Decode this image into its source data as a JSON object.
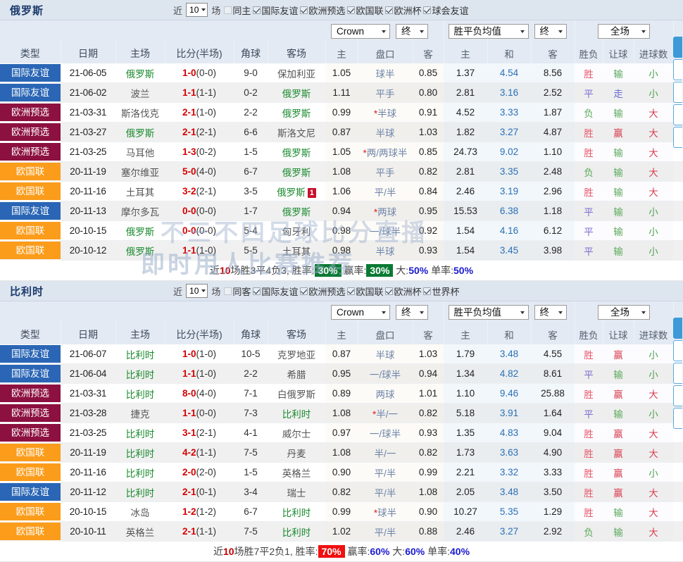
{
  "panels": [
    {
      "title": "俄罗斯",
      "controls": {
        "recent_label": "近",
        "count": "10",
        "matches_label": "场",
        "same_side_label": "同主",
        "same_side_checked": false,
        "filters": [
          {
            "label": "国际友谊",
            "checked": true
          },
          {
            "label": "欧洲预选",
            "checked": true
          },
          {
            "label": "欧国联",
            "checked": true
          },
          {
            "label": "欧洲杯",
            "checked": true
          },
          {
            "label": "球会友谊",
            "checked": true
          }
        ]
      },
      "selects": {
        "company": "Crown",
        "odds_stage": "终",
        "odds_type": "胜平负均值",
        "odds_stage2": "终",
        "period": "全场"
      },
      "columns": [
        "类型",
        "日期",
        "主场",
        "比分(半场)",
        "角球",
        "客场"
      ],
      "sub_columns": [
        "主",
        "盘口",
        "客",
        "主",
        "和",
        "客",
        "胜负",
        "让球",
        "进球数"
      ],
      "rows": [
        {
          "tag": "国际友谊",
          "tagclass": "friendly",
          "date": "21-06-05",
          "home": "俄罗斯",
          "home_hi": true,
          "score": "1-0",
          "half": "(0-0)",
          "corner": "9-0",
          "away": "保加利亚",
          "away_hi": false,
          "badge": "",
          "h_odds": "1.05",
          "handicap": "球半",
          "star": false,
          "a_odds": "0.85",
          "w": "1.37",
          "d": "4.54",
          "l": "8.56",
          "res": "胜",
          "res_c": "r-win",
          "hcp": "输",
          "hcp_c": "r-lose",
          "ou": "小",
          "ou_c": "r-green"
        },
        {
          "tag": "国际友谊",
          "tagclass": "friendly",
          "date": "21-06-02",
          "home": "波兰",
          "home_hi": false,
          "score": "1-1",
          "half": "(1-1)",
          "corner": "0-2",
          "away": "俄罗斯",
          "away_hi": true,
          "badge": "",
          "h_odds": "1.11",
          "handicap": "平手",
          "star": false,
          "a_odds": "0.80",
          "w": "2.81",
          "d": "3.16",
          "l": "2.52",
          "res": "平",
          "res_c": "r-draw",
          "hcp": "走",
          "hcp_c": "r-blue",
          "ou": "小",
          "ou_c": "r-green"
        },
        {
          "tag": "欧洲预选",
          "tagclass": "euroqual",
          "date": "21-03-31",
          "home": "斯洛伐克",
          "home_hi": false,
          "score": "2-1",
          "half": "(1-0)",
          "corner": "2-2",
          "away": "俄罗斯",
          "away_hi": true,
          "badge": "",
          "h_odds": "0.99",
          "handicap": "半球",
          "star": true,
          "a_odds": "0.91",
          "w": "4.52",
          "d": "3.33",
          "l": "1.87",
          "res": "负",
          "res_c": "r-lose",
          "hcp": "输",
          "hcp_c": "r-lose",
          "ou": "大",
          "ou_c": "r-red"
        },
        {
          "tag": "欧洲预选",
          "tagclass": "euroqual",
          "date": "21-03-27",
          "home": "俄罗斯",
          "home_hi": true,
          "score": "2-1",
          "half": "(2-1)",
          "corner": "6-6",
          "away": "斯洛文尼",
          "away_hi": false,
          "badge": "",
          "h_odds": "0.87",
          "handicap": "半球",
          "star": false,
          "a_odds": "1.03",
          "w": "1.82",
          "d": "3.27",
          "l": "4.87",
          "res": "胜",
          "res_c": "r-win",
          "hcp": "赢",
          "hcp_c": "r-red",
          "ou": "大",
          "ou_c": "r-red"
        },
        {
          "tag": "欧洲预选",
          "tagclass": "euroqual",
          "date": "21-03-25",
          "home": "马耳他",
          "home_hi": false,
          "score": "1-3",
          "half": "(0-2)",
          "corner": "1-5",
          "away": "俄罗斯",
          "away_hi": true,
          "badge": "",
          "h_odds": "1.05",
          "handicap": "两/两球半",
          "star": true,
          "a_odds": "0.85",
          "w": "24.73",
          "d": "9.02",
          "l": "1.10",
          "res": "胜",
          "res_c": "r-win",
          "hcp": "输",
          "hcp_c": "r-lose",
          "ou": "大",
          "ou_c": "r-red"
        },
        {
          "tag": "欧国联",
          "tagclass": "nationsleague",
          "date": "20-11-19",
          "home": "塞尔维亚",
          "home_hi": false,
          "score": "5-0",
          "half": "(4-0)",
          "corner": "6-7",
          "away": "俄罗斯",
          "away_hi": true,
          "badge": "",
          "h_odds": "1.08",
          "handicap": "平手",
          "star": false,
          "a_odds": "0.82",
          "w": "2.81",
          "d": "3.35",
          "l": "2.48",
          "res": "负",
          "res_c": "r-lose",
          "hcp": "输",
          "hcp_c": "r-lose",
          "ou": "大",
          "ou_c": "r-red"
        },
        {
          "tag": "欧国联",
          "tagclass": "nationsleague",
          "date": "20-11-16",
          "home": "土耳其",
          "home_hi": false,
          "score": "3-2",
          "half": "(2-1)",
          "corner": "3-5",
          "away": "俄罗斯",
          "away_hi": true,
          "badge": "1",
          "h_odds": "1.06",
          "handicap": "平/半",
          "star": false,
          "a_odds": "0.84",
          "w": "2.46",
          "d": "3.19",
          "l": "2.96",
          "res": "胜",
          "res_c": "r-win",
          "hcp": "输",
          "hcp_c": "r-lose",
          "ou": "大",
          "ou_c": "r-red"
        },
        {
          "tag": "国际友谊",
          "tagclass": "friendly",
          "date": "20-11-13",
          "home": "摩尔多瓦",
          "home_hi": false,
          "score": "0-0",
          "half": "(0-0)",
          "corner": "1-7",
          "away": "俄罗斯",
          "away_hi": true,
          "badge": "",
          "h_odds": "0.94",
          "handicap": "两球",
          "star": true,
          "a_odds": "0.95",
          "w": "15.53",
          "d": "6.38",
          "l": "1.18",
          "res": "平",
          "res_c": "r-draw",
          "hcp": "输",
          "hcp_c": "r-lose",
          "ou": "小",
          "ou_c": "r-green"
        },
        {
          "tag": "欧国联",
          "tagclass": "nationsleague",
          "date": "20-10-15",
          "home": "俄罗斯",
          "home_hi": true,
          "score": "0-0",
          "half": "(0-0)",
          "corner": "5-4",
          "away": "匈牙利",
          "away_hi": false,
          "badge": "",
          "h_odds": "0.98",
          "handicap": "一/球半",
          "star": false,
          "a_odds": "0.92",
          "w": "1.54",
          "d": "4.16",
          "l": "6.12",
          "res": "平",
          "res_c": "r-draw",
          "hcp": "输",
          "hcp_c": "r-lose",
          "ou": "小",
          "ou_c": "r-green"
        },
        {
          "tag": "欧国联",
          "tagclass": "nationsleague",
          "date": "20-10-12",
          "home": "俄罗斯",
          "home_hi": true,
          "score": "1-1",
          "half": "(1-0)",
          "corner": "5-5",
          "away": "土耳其",
          "away_hi": false,
          "badge": "",
          "h_odds": "0.98",
          "handicap": "半球",
          "star": false,
          "a_odds": "0.93",
          "w": "1.54",
          "d": "3.45",
          "l": "3.98",
          "res": "平",
          "res_c": "r-draw",
          "hcp": "输",
          "hcp_c": "r-lose",
          "ou": "小",
          "ou_c": "r-green"
        }
      ],
      "summary": {
        "prefix": "近",
        "count": "10",
        "matches": "场",
        "record": "胜3平4负3,",
        "winrate_label": "胜率:",
        "winrate": "30%",
        "hcprate_label": "赢率:",
        "hcprate": "30%",
        "over_label": "大:",
        "over": "50%",
        "odd_label": "单率:",
        "odd": "50%",
        "winrate_style": "green",
        "hcprate_style": "green"
      }
    },
    {
      "title": "比利时",
      "controls": {
        "recent_label": "近",
        "count": "10",
        "matches_label": "场",
        "same_side_label": "同客",
        "same_side_checked": false,
        "filters": [
          {
            "label": "国际友谊",
            "checked": true
          },
          {
            "label": "欧洲预选",
            "checked": true
          },
          {
            "label": "欧国联",
            "checked": true
          },
          {
            "label": "欧洲杯",
            "checked": true
          },
          {
            "label": "世界杯",
            "checked": true
          }
        ]
      },
      "selects": {
        "company": "Crown",
        "odds_stage": "终",
        "odds_type": "胜平负均值",
        "odds_stage2": "终",
        "period": "全场"
      },
      "columns": [
        "类型",
        "日期",
        "主场",
        "比分(半场)",
        "角球",
        "客场"
      ],
      "sub_columns": [
        "主",
        "盘口",
        "客",
        "主",
        "和",
        "客",
        "胜负",
        "让球",
        "进球数"
      ],
      "rows": [
        {
          "tag": "国际友谊",
          "tagclass": "friendly",
          "date": "21-06-07",
          "home": "比利时",
          "home_hi": true,
          "score": "1-0",
          "half": "(1-0)",
          "corner": "10-5",
          "away": "克罗地亚",
          "away_hi": false,
          "badge": "",
          "h_odds": "0.87",
          "handicap": "半球",
          "star": false,
          "a_odds": "1.03",
          "w": "1.79",
          "d": "3.48",
          "l": "4.55",
          "res": "胜",
          "res_c": "r-win",
          "hcp": "赢",
          "hcp_c": "r-red",
          "ou": "小",
          "ou_c": "r-green"
        },
        {
          "tag": "国际友谊",
          "tagclass": "friendly",
          "date": "21-06-04",
          "home": "比利时",
          "home_hi": true,
          "score": "1-1",
          "half": "(1-0)",
          "corner": "2-2",
          "away": "希腊",
          "away_hi": false,
          "badge": "",
          "h_odds": "0.95",
          "handicap": "一/球半",
          "star": false,
          "a_odds": "0.94",
          "w": "1.34",
          "d": "4.82",
          "l": "8.61",
          "res": "平",
          "res_c": "r-draw",
          "hcp": "输",
          "hcp_c": "r-lose",
          "ou": "小",
          "ou_c": "r-green"
        },
        {
          "tag": "欧洲预选",
          "tagclass": "euroqual",
          "date": "21-03-31",
          "home": "比利时",
          "home_hi": true,
          "score": "8-0",
          "half": "(4-0)",
          "corner": "7-1",
          "away": "白俄罗斯",
          "away_hi": false,
          "badge": "",
          "h_odds": "0.89",
          "handicap": "两球",
          "star": false,
          "a_odds": "1.01",
          "w": "1.10",
          "d": "9.46",
          "l": "25.88",
          "res": "胜",
          "res_c": "r-win",
          "hcp": "赢",
          "hcp_c": "r-red",
          "ou": "大",
          "ou_c": "r-red"
        },
        {
          "tag": "欧洲预选",
          "tagclass": "euroqual",
          "date": "21-03-28",
          "home": "捷克",
          "home_hi": false,
          "score": "1-1",
          "half": "(0-0)",
          "corner": "7-3",
          "away": "比利时",
          "away_hi": true,
          "badge": "",
          "h_odds": "1.08",
          "handicap": "半/一",
          "star": true,
          "a_odds": "0.82",
          "w": "5.18",
          "d": "3.91",
          "l": "1.64",
          "res": "平",
          "res_c": "r-draw",
          "hcp": "输",
          "hcp_c": "r-lose",
          "ou": "小",
          "ou_c": "r-green"
        },
        {
          "tag": "欧洲预选",
          "tagclass": "euroqual",
          "date": "21-03-25",
          "home": "比利时",
          "home_hi": true,
          "score": "3-1",
          "half": "(2-1)",
          "corner": "4-1",
          "away": "威尔士",
          "away_hi": false,
          "badge": "",
          "h_odds": "0.97",
          "handicap": "一/球半",
          "star": false,
          "a_odds": "0.93",
          "w": "1.35",
          "d": "4.83",
          "l": "9.04",
          "res": "胜",
          "res_c": "r-win",
          "hcp": "赢",
          "hcp_c": "r-red",
          "ou": "大",
          "ou_c": "r-red"
        },
        {
          "tag": "欧国联",
          "tagclass": "nationsleague",
          "date": "20-11-19",
          "home": "比利时",
          "home_hi": true,
          "score": "4-2",
          "half": "(1-1)",
          "corner": "7-5",
          "away": "丹麦",
          "away_hi": false,
          "badge": "",
          "h_odds": "1.08",
          "handicap": "半/一",
          "star": false,
          "a_odds": "0.82",
          "w": "1.73",
          "d": "3.63",
          "l": "4.90",
          "res": "胜",
          "res_c": "r-win",
          "hcp": "赢",
          "hcp_c": "r-red",
          "ou": "大",
          "ou_c": "r-red"
        },
        {
          "tag": "欧国联",
          "tagclass": "nationsleague",
          "date": "20-11-16",
          "home": "比利时",
          "home_hi": true,
          "score": "2-0",
          "half": "(2-0)",
          "corner": "1-5",
          "away": "英格兰",
          "away_hi": false,
          "badge": "",
          "h_odds": "0.90",
          "handicap": "平/半",
          "star": false,
          "a_odds": "0.99",
          "w": "2.21",
          "d": "3.32",
          "l": "3.33",
          "res": "胜",
          "res_c": "r-win",
          "hcp": "赢",
          "hcp_c": "r-red",
          "ou": "小",
          "ou_c": "r-green"
        },
        {
          "tag": "国际友谊",
          "tagclass": "friendly",
          "date": "20-11-12",
          "home": "比利时",
          "home_hi": true,
          "score": "2-1",
          "half": "(0-1)",
          "corner": "3-4",
          "away": "瑞士",
          "away_hi": false,
          "badge": "",
          "h_odds": "0.82",
          "handicap": "平/半",
          "star": false,
          "a_odds": "1.08",
          "w": "2.05",
          "d": "3.48",
          "l": "3.50",
          "res": "胜",
          "res_c": "r-win",
          "hcp": "赢",
          "hcp_c": "r-red",
          "ou": "大",
          "ou_c": "r-red"
        },
        {
          "tag": "欧国联",
          "tagclass": "nationsleague",
          "date": "20-10-15",
          "home": "冰岛",
          "home_hi": false,
          "score": "1-2",
          "half": "(1-2)",
          "corner": "6-7",
          "away": "比利时",
          "away_hi": true,
          "badge": "",
          "h_odds": "0.99",
          "handicap": "球半",
          "star": true,
          "a_odds": "0.90",
          "w": "10.27",
          "d": "5.35",
          "l": "1.29",
          "res": "胜",
          "res_c": "r-win",
          "hcp": "输",
          "hcp_c": "r-lose",
          "ou": "大",
          "ou_c": "r-red"
        },
        {
          "tag": "欧国联",
          "tagclass": "nationsleague",
          "date": "20-10-11",
          "home": "英格兰",
          "home_hi": false,
          "score": "2-1",
          "half": "(1-1)",
          "corner": "7-5",
          "away": "比利时",
          "away_hi": true,
          "badge": "",
          "h_odds": "1.02",
          "handicap": "平/半",
          "star": false,
          "a_odds": "0.88",
          "w": "2.46",
          "d": "3.27",
          "l": "2.92",
          "res": "负",
          "res_c": "r-lose",
          "hcp": "输",
          "hcp_c": "r-lose",
          "ou": "大",
          "ou_c": "r-red"
        }
      ],
      "summary": {
        "prefix": "近",
        "count": "10",
        "matches": "场",
        "record": "胜7平2负1,",
        "winrate_label": "胜率:",
        "winrate": "70%",
        "hcprate_label": "赢率:",
        "hcprate": "60%",
        "over_label": "大:",
        "over": "60%",
        "odd_label": "单率:",
        "odd": "40%",
        "winrate_style": "red",
        "hcprate_style": "plain"
      }
    }
  ],
  "watermark": {
    "line1": "不三不四足球比分直播",
    "line2": "即时用人比赛推荐"
  },
  "edge_tabs": 5
}
